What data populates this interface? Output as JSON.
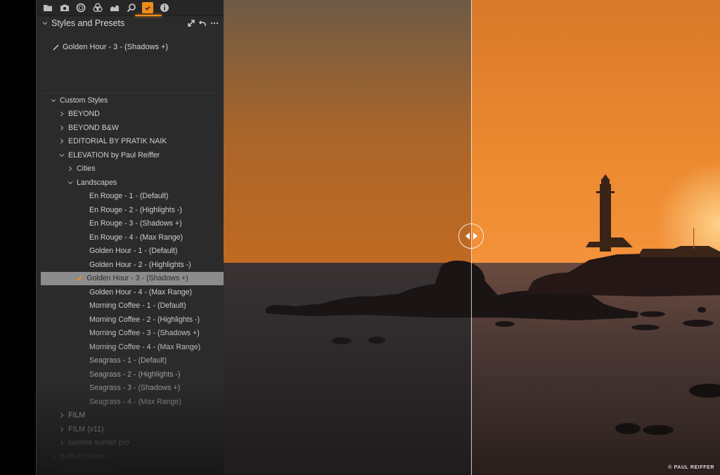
{
  "toolbar": {
    "tabs": [
      {
        "icon": "folder-icon",
        "label": "Library"
      },
      {
        "icon": "camera-icon",
        "label": "Capture"
      },
      {
        "icon": "lens-icon",
        "label": "Lens"
      },
      {
        "icon": "color-icon",
        "label": "Color"
      },
      {
        "icon": "exposure-icon",
        "label": "Exposure"
      },
      {
        "icon": "details-icon",
        "label": "Details"
      },
      {
        "icon": "adjustments-icon",
        "label": "Adjustments",
        "active": true
      },
      {
        "icon": "info-icon",
        "label": "Metadata"
      }
    ],
    "accent_color": "#f08c1a"
  },
  "tool": {
    "title": "Styles and Presets",
    "applied_style": "Golden Hour - 3 - (Shadows +)"
  },
  "tree": {
    "custom_styles": "Custom Styles",
    "groups": {
      "beyond": "BEYOND",
      "beyond_bw": "BEYOND B&W",
      "editorial": "EDITORIAL BY PRATIK NAIK",
      "elevation": "ELEVATION by Paul Reiffer",
      "cities": "Cities",
      "landscapes": "Landscapes",
      "film": "FILM",
      "film_v11": "FILM (v11)",
      "sunrise": "sunrise sunset pro",
      "builtin": "Built-in Styles",
      "custom_presets": "Custom Presets"
    },
    "landscape_styles": [
      "En Rouge - 1 - (Default)",
      "En Rouge - 2 - (Highlights -)",
      "En Rouge - 3 - (Shadows +)",
      "En Rouge - 4 - (Max Range)",
      "Golden Hour - 1 - (Default)",
      "Golden Hour - 2 - (Highlights -)",
      "Golden Hour - 3 - (Shadows +)",
      "Golden Hour - 4 - (Max Range)",
      "Morning Coffee - 1 - (Default)",
      "Morning Coffee - 2 - (Highlights -)",
      "Morning Coffee - 3 - (Shadows +)",
      "Morning Coffee - 4 - (Max Range)",
      "Seagrass - 1 - (Default)",
      "Seagrass - 2 - (Highlights -)",
      "Seagrass - 3 - (Shadows +)",
      "Seagrass - 4 - (Max Range)"
    ],
    "selected_index": 6
  },
  "viewer": {
    "copyright": "© PAUL REIFFER",
    "mode": "before/after split"
  }
}
